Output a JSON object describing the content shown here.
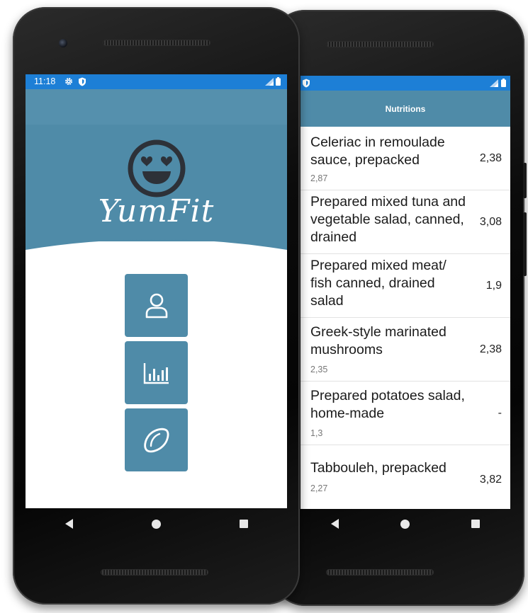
{
  "left_phone": {
    "status_bar": {
      "time": "11:18",
      "icons": [
        "gear-icon",
        "shield-icon",
        "signal-icon",
        "battery-icon"
      ]
    },
    "app": {
      "logo_text": "YumFit",
      "logo_icon": "heart-eyes-face-icon",
      "menu_buttons": [
        {
          "icon": "profile-icon"
        },
        {
          "icon": "bar-chart-icon"
        },
        {
          "icon": "lemon-icon"
        }
      ]
    },
    "nav": [
      "back",
      "home",
      "recents"
    ]
  },
  "right_phone": {
    "status_bar": {
      "icons": [
        "shield-icon",
        "signal-icon",
        "battery-icon"
      ]
    },
    "app_bar": {
      "title": "Nutritions"
    },
    "list": [
      {
        "name": "Celeriac in remoulade sauce, prepacked",
        "sub": "2,87",
        "value": "2,38"
      },
      {
        "name": "Prepared mixed tuna and vegetable salad, canned, drained",
        "sub": "",
        "value": "3,08"
      },
      {
        "name": "Prepared mixed meat/ fish canned, drained salad",
        "sub": "",
        "value": "1,9"
      },
      {
        "name": "Greek-style marinated mushrooms",
        "sub": "2,35",
        "value": "2,38"
      },
      {
        "name": "Prepared potatoes salad, home-made",
        "sub": "1,3",
        "value": "-"
      },
      {
        "name": "Tabbouleh, prepacked",
        "sub": "2,27",
        "value": "3,82"
      }
    ],
    "nav": [
      "back",
      "home",
      "recents"
    ]
  },
  "colors": {
    "primary": "#4f8ba8",
    "status_bar": "#1d7fd6",
    "white": "#ffffff"
  }
}
